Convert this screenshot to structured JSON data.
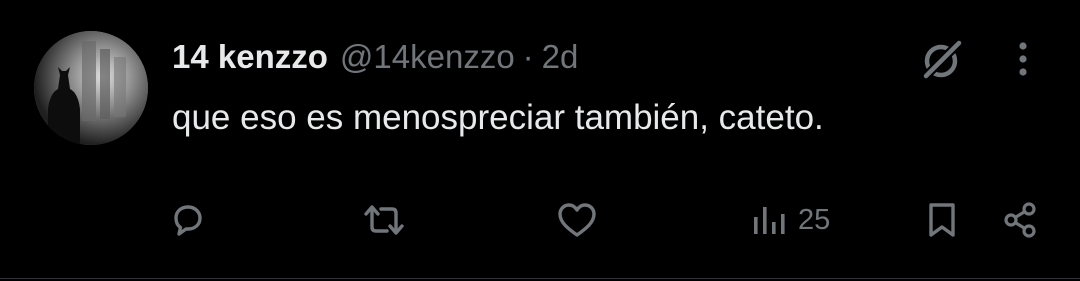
{
  "tweet": {
    "display_name": "14 kenzzo",
    "handle": "@14kenzzo",
    "separator": "·",
    "time": "2d",
    "text": "que eso es menospreciar también, cateto."
  },
  "actions": {
    "reply": {
      "icon": "reply-icon"
    },
    "retweet": {
      "icon": "retweet-icon"
    },
    "like": {
      "icon": "heart-icon"
    },
    "views": {
      "icon": "views-chart-icon",
      "count": "25"
    },
    "bookmark": {
      "icon": "bookmark-icon"
    },
    "share": {
      "icon": "share-icon"
    }
  },
  "header_icons": {
    "grok": "grok-icon",
    "more": "more-vertical-icon"
  },
  "colors": {
    "background": "#000000",
    "primary_text": "#e7e9ea",
    "secondary_text": "#71767b",
    "divider": "#2f3336"
  }
}
